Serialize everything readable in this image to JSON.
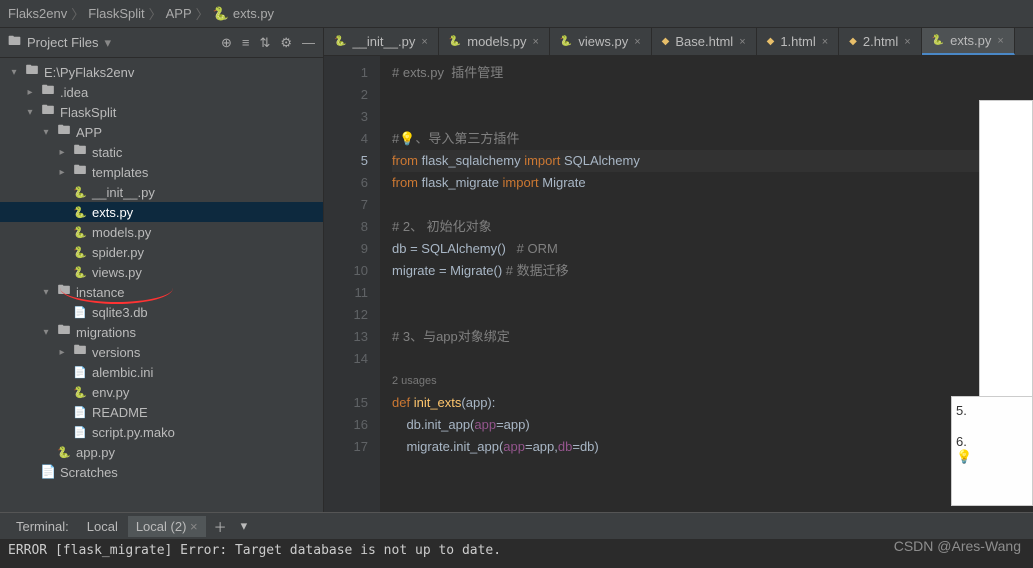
{
  "breadcrumb": [
    "Flaks2env",
    "FlaskSplit",
    "APP",
    "exts.py"
  ],
  "sidebar": {
    "title": "Project Files",
    "tree": [
      {
        "d": 0,
        "t": "dir",
        "open": true,
        "label": "E:\\PyFlaks2env",
        "arrow": "v"
      },
      {
        "d": 1,
        "t": "dir",
        "open": false,
        "label": ".idea",
        "arrow": ">"
      },
      {
        "d": 1,
        "t": "dir",
        "open": true,
        "label": "FlaskSplit",
        "arrow": "v"
      },
      {
        "d": 2,
        "t": "dir",
        "open": true,
        "label": "APP",
        "arrow": "v"
      },
      {
        "d": 3,
        "t": "dir",
        "open": false,
        "label": "static",
        "arrow": ">"
      },
      {
        "d": 3,
        "t": "dir",
        "open": false,
        "label": "templates",
        "arrow": ">"
      },
      {
        "d": 3,
        "t": "py",
        "label": "__init__.py"
      },
      {
        "d": 3,
        "t": "py",
        "label": "exts.py",
        "sel": true
      },
      {
        "d": 3,
        "t": "py",
        "label": "models.py"
      },
      {
        "d": 3,
        "t": "py",
        "label": "spider.py"
      },
      {
        "d": 3,
        "t": "py",
        "label": "views.py"
      },
      {
        "d": 2,
        "t": "dir",
        "open": true,
        "label": "instance",
        "arrow": "v"
      },
      {
        "d": 3,
        "t": "file",
        "label": "sqlite3.db"
      },
      {
        "d": 2,
        "t": "dir",
        "open": true,
        "label": "migrations",
        "arrow": "v"
      },
      {
        "d": 3,
        "t": "dir",
        "open": false,
        "label": "versions",
        "arrow": ">"
      },
      {
        "d": 3,
        "t": "file",
        "label": "alembic.ini"
      },
      {
        "d": 3,
        "t": "py",
        "label": "env.py"
      },
      {
        "d": 3,
        "t": "file",
        "label": "README"
      },
      {
        "d": 3,
        "t": "file",
        "label": "script.py.mako"
      },
      {
        "d": 2,
        "t": "py",
        "label": "app.py"
      },
      {
        "d": 1,
        "t": "scratch",
        "label": "Scratches"
      }
    ]
  },
  "tabs": [
    {
      "label": "__init__.py",
      "icon": "py"
    },
    {
      "label": "models.py",
      "icon": "py"
    },
    {
      "label": "views.py",
      "icon": "py"
    },
    {
      "label": "Base.html",
      "icon": "html"
    },
    {
      "label": "1.html",
      "icon": "html"
    },
    {
      "label": "2.html",
      "icon": "html"
    },
    {
      "label": "exts.py",
      "icon": "py",
      "active": true
    }
  ],
  "code": {
    "usages": "2 usages",
    "lines": [
      {
        "n": 1,
        "html": "<span class='cm'># exts.py  插件管理</span>"
      },
      {
        "n": 2,
        "html": ""
      },
      {
        "n": 3,
        "html": ""
      },
      {
        "n": 4,
        "html": "<span class='cm'>#<span class='bulb'>💡</span>、导入第三方插件</span>"
      },
      {
        "n": 5,
        "hl": true,
        "html": "<span class='kw'>from</span> flask_sqlalchemy <span class='kw'>import</span> SQLAlchemy"
      },
      {
        "n": 6,
        "html": "<span class='kw'>from</span> flask_migrate <span class='kw'>import</span> Migrate"
      },
      {
        "n": 7,
        "html": ""
      },
      {
        "n": 8,
        "html": "<span class='cm'># 2、 初始化对象</span>"
      },
      {
        "n": 9,
        "html": "db = SQLAlchemy()   <span class='cm'># ORM</span>"
      },
      {
        "n": 10,
        "html": "migrate = Migrate() <span class='cm'># 数据迁移</span>"
      },
      {
        "n": 11,
        "html": ""
      },
      {
        "n": 12,
        "html": ""
      },
      {
        "n": 13,
        "html": "<span class='cm'># 3、与app对象绑定</span>"
      },
      {
        "n": 14,
        "html": ""
      },
      {
        "n": "u",
        "usages": true
      },
      {
        "n": 15,
        "html": "<span class='kw'>def</span> <span class='fn'>init_exts</span>(app):"
      },
      {
        "n": 16,
        "html": "    db.init_app(<span class='self'>app</span>=app)"
      },
      {
        "n": 17,
        "html": "    migrate.init_app(<span class='self'>app</span>=app,<span class='self'>db</span>=db)"
      }
    ]
  },
  "terminal": {
    "label": "Terminal:",
    "tabs": [
      {
        "label": "Local"
      },
      {
        "label": "Local (2)",
        "active": true
      }
    ],
    "output": "ERROR [flask_migrate] Error: Target database is not up to date."
  },
  "overlay": {
    "l5": "5.",
    "l6": "6."
  },
  "watermark": "CSDN @Ares-Wang"
}
